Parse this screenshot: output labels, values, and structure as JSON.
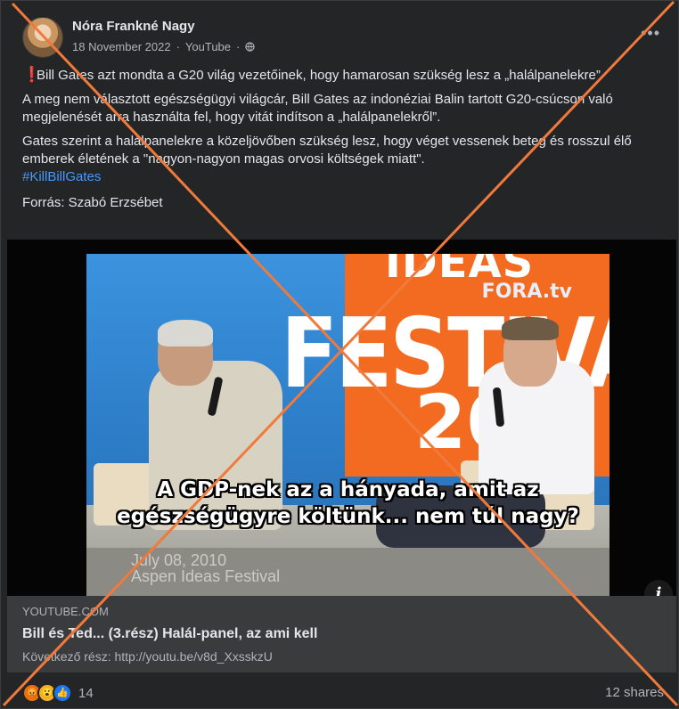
{
  "post": {
    "author": "Nóra Frankné Nagy",
    "date": "18 November 2022",
    "separator": "·",
    "source_app": "YouTube",
    "audience_icon": "globe-icon",
    "more_icon": "more-options-icon",
    "headline": "Bill Gates azt mondta a G20 világ vezetőinek, hogy hamarosan szükség lesz a „halálpanelekre”",
    "paragraph_1": "A meg nem választott egészségügyi világcár, Bill Gates az indonéziai Balin tartott G20-csúcson való megjelenését arra használta fel, hogy vitát indítson a „halálpanelekről”.",
    "paragraph_2": "Gates szerint a halálpanelekre a közeljövőben szükség lesz, hogy véget vessenek beteg és rosszul élő emberek életének a \"nagyon-nagyon magas orvosi költségek miatt\".",
    "hashtag": "#KillBillGates",
    "source_line": "Forrás: Szabó Erzsébet"
  },
  "video": {
    "banner_text": "FESTIVA",
    "banner_top": "IDEAS",
    "banner_year": "20",
    "logo": "FORA.tv",
    "watermark_line_1": "July 08, 2010",
    "watermark_line_2": "Aspen Ideas Festival",
    "subtitle_line_1": "A GDP-nek az a hányada, amit az",
    "subtitle_line_2": "egészségügyre költünk... nem túl nagy?",
    "info_label": "i"
  },
  "link_preview": {
    "domain": "YOUTUBE.COM",
    "title": "Bill és Ted... (3.rész) Halál-panel, az ami kell",
    "description": "Következő rész: http://youtu.be/v8d_XxsskzU"
  },
  "footer": {
    "reaction_count": "14",
    "shares": "12 shares",
    "reactions": [
      "angry-reaction-icon",
      "wow-reaction-icon",
      "like-reaction-icon"
    ]
  },
  "colors": {
    "overlay_x": "#f07a3c",
    "hashtag": "#4599ff",
    "background": "#242526"
  }
}
